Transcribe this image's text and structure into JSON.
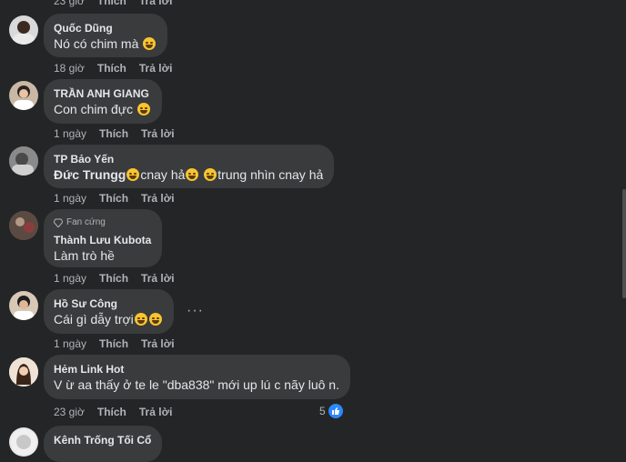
{
  "top": {
    "time": "23 giờ",
    "like": "Thích",
    "reply": "Trả lời"
  },
  "comments": [
    {
      "name": "Quốc Dũng",
      "text": "Nó có chim mà",
      "time": "18 giờ",
      "like": "Thích",
      "reply": "Trả lời"
    },
    {
      "name": "TRẦN ANH GIANG",
      "text": "Con chim đực",
      "time": "1 ngày",
      "like": "Thích",
      "reply": "Trả lời"
    },
    {
      "name": "TP Bảo Yến",
      "mention": "Đức Trungg",
      "text1": "cnay hả",
      "text2": "trung nhìn cnay hả",
      "time": "1 ngày",
      "like": "Thích",
      "reply": "Trả lời"
    },
    {
      "badge": "Fan cứng",
      "name": "Thành Lưu Kubota",
      "text": "Làm trò hề",
      "time": "1 ngày",
      "like": "Thích",
      "reply": "Trả lời"
    },
    {
      "name": "Hồ Sư Công",
      "text": "Cái gì dẫy trợi",
      "time": "1 ngày",
      "like": "Thích",
      "reply": "Trả lời",
      "more": "···"
    },
    {
      "name": "Hẻm Link Hot",
      "text": "V ừ aa thấy ở te le \"dba838\" mới up lú c nãy luô n.",
      "time": "23 giờ",
      "like": "Thích",
      "reply": "Trả lời",
      "reactions": "5"
    },
    {
      "name": "Kênh Trống Tối Cổ"
    }
  ],
  "icons": {
    "like": "like-icon",
    "emoji": "emoji-icon",
    "badge": "diamond-icon"
  }
}
